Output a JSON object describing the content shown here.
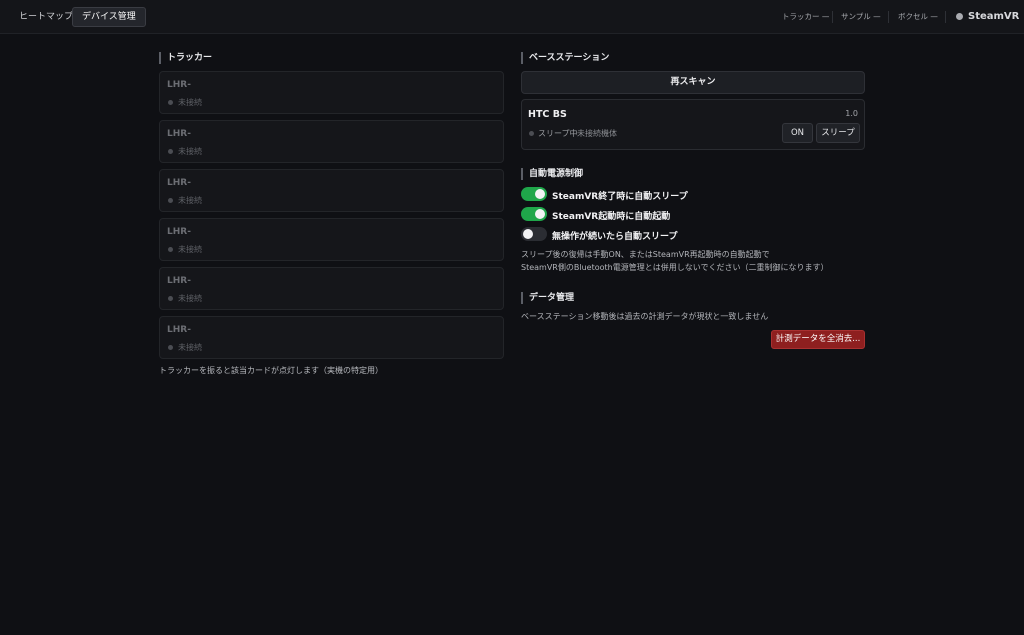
{
  "header": {
    "tabs": [
      {
        "label": "ヒートマップ",
        "active": false
      },
      {
        "label": "デバイス管理",
        "active": true
      }
    ],
    "stats": [
      {
        "label": "トラッカー —"
      },
      {
        "label": "サンプル —"
      },
      {
        "label": "ボクセル —"
      }
    ],
    "connection": {
      "label": "SteamVR",
      "status_color": "#a9abb0"
    }
  },
  "trackers": {
    "title": "トラッカー",
    "items": [
      {
        "name": "LHR-",
        "status": "未接続"
      },
      {
        "name": "LHR-",
        "status": "未接続"
      },
      {
        "name": "LHR-",
        "status": "未接続"
      },
      {
        "name": "LHR-",
        "status": "未接続"
      },
      {
        "name": "LHR-",
        "status": "未接続"
      },
      {
        "name": "LHR-",
        "status": "未接続"
      }
    ],
    "hint": "トラッカーを振ると該当カードが点灯します（実機の特定用）"
  },
  "base_station": {
    "title": "ベースステーション",
    "rescan_label": "再スキャン",
    "device": {
      "name": "HTC BS",
      "version": "1.0",
      "state": "スリープ中",
      "note": "未接続機体",
      "on_label": "ON",
      "sleep_label": "スリープ"
    }
  },
  "auto_power": {
    "title": "自動電源制御",
    "toggles": [
      {
        "label": "SteamVR終了時に自動スリープ",
        "on": true
      },
      {
        "label": "SteamVR起動時に自動起動",
        "on": true
      },
      {
        "label": "無操作が続いたら自動スリープ",
        "on": false
      }
    ],
    "note_line1": "スリープ後の復帰は手動ON、またはSteamVR再起動時の自動起動で",
    "note_line2": "SteamVR側のBluetooth電源管理とは併用しないでください（二重制御になります）"
  },
  "data_mgmt": {
    "title": "データ管理",
    "note": "ベースステーション移動後は過去の計測データが現状と一致しません",
    "clear_label": "計測データを全消去..."
  },
  "colors": {
    "background": "#0f1014",
    "toggle_on": "#1fa64a",
    "danger": "#8e1f1f"
  }
}
